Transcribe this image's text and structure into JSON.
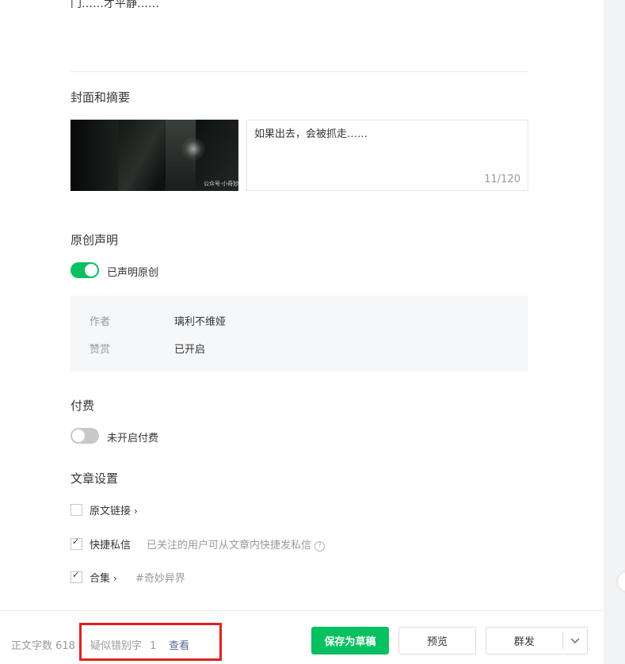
{
  "content": {
    "top_fragment": "门……才平静……"
  },
  "cover_section": {
    "title": "封面和摘要",
    "cover_watermark": "公众号·小奇妙",
    "summary_text": "如果出去，会被抓走……",
    "summary_count": "11/120"
  },
  "original_section": {
    "title": "原创声明",
    "toggle_label": "已声明原创",
    "rows": [
      {
        "key": "作者",
        "value": "璃利不维娅"
      },
      {
        "key": "赞赏",
        "value": "已开启"
      }
    ]
  },
  "pay_section": {
    "title": "付费",
    "toggle_label": "未开启付费"
  },
  "settings_section": {
    "title": "文章设置",
    "source_link": "原文链接",
    "quick_message": "快捷私信",
    "quick_message_desc": "已关注的用户可从文章内快捷发私信",
    "collection": "合集",
    "collection_tag": "#奇妙异界"
  },
  "footer": {
    "word_count": "正文字数 618",
    "typo_label": "疑似错别字",
    "typo_count": "1",
    "typo_link": "查看",
    "save_draft": "保存为草稿",
    "preview": "预览",
    "mass_send": "群发"
  },
  "colors": {
    "accent": "#07c160",
    "link": "#576b95",
    "highlight": "#e02020"
  }
}
